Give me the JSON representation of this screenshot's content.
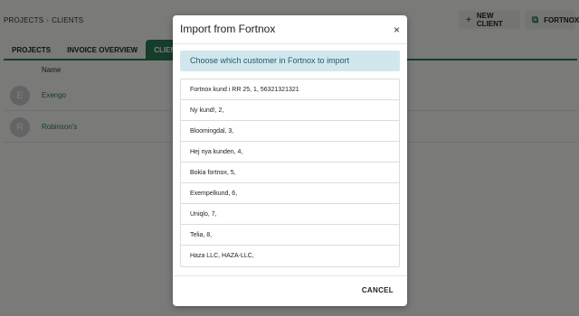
{
  "breadcrumb": {
    "root": "PROJECTS",
    "separator": "›",
    "current": "CLIENTS"
  },
  "toolbar": {
    "new_client": {
      "icon": "plus-icon",
      "label": "NEW CLIENT"
    },
    "fortnox": {
      "icon": "fortnox-icon",
      "label": "FORTNOX"
    }
  },
  "tabs": [
    {
      "label": "PROJECTS",
      "active": false
    },
    {
      "label": "INVOICE OVERVIEW",
      "active": false
    },
    {
      "label": "CLIENTS",
      "active": true
    }
  ],
  "table": {
    "column_name": "Name",
    "rows": [
      {
        "initial": "E",
        "name": "Exengo"
      },
      {
        "initial": "R",
        "name": "Robinson's"
      }
    ]
  },
  "modal": {
    "title": "Import from Fortnox",
    "close_symbol": "×",
    "info": "Choose which customer in Fortnox to import",
    "customers": [
      "Fortnox kund i RR 25,  1,  56321321321",
      "Ny kund!,  2,",
      "Bloomingdal,  3,",
      "Hej nya kunden,  4,",
      "Bokia fortnox,  5,",
      "Exempelkund,  6,",
      "Uniqlo,  7,",
      "Telia,  8,",
      "Haza LLC,  HAZA-LLC,"
    ],
    "cancel_label": "CANCEL"
  },
  "colors": {
    "accent": "#2a7a55",
    "info_bg": "#d1e7ed",
    "info_text": "#1f5a68",
    "overlay": "rgba(0,0,0,0.5)"
  }
}
